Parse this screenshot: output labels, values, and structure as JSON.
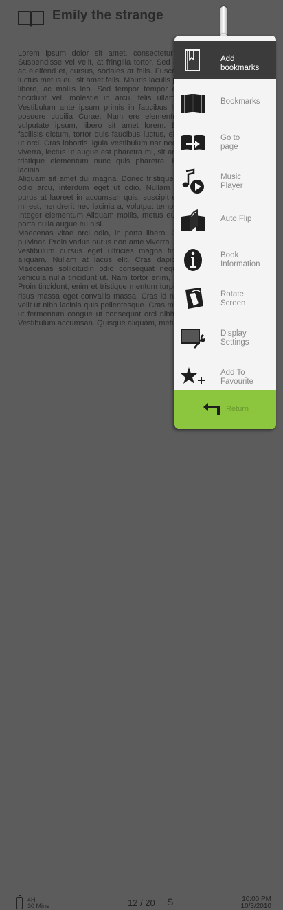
{
  "header": {
    "title": "Emily the strange"
  },
  "reader": {
    "paragraphs": [
      "Lorem ipsum dolor sit amet, consectetur adipiscing elit. Suspendisse vel velit, at fringilla tortor. Sed dui augue, porta ac eleifend et, cursus, sodales at felis. Fusce a risus laoreet, luctus metus eu, sit amet felis. Mauris iaculis pellentesque orci libero, ac mollis leo. Sed tempor tempor orci, ornare non tincidunt vel, molestie in arcu. felis ullamcorper ultricies. Vestibulum ante ipsum primis in faucibus luctus et ultrices posuere cubilia Curae; Nam ere elementum, metus felis vulputate ipsum, libero sit amet lorem. Etiam commodo facilisis dictum, tortor quis faucibus luctus, elit libero odio elit ut orci. Cras lobortis ligula vestibulum nar neque lobortis. Sed viverra, lectus ut augue est pharetra mi, sit amet lobortis risus tristique elementum nunc quis pharetra. Etiam commodo lacinia.",
      "Aliquam sit amet dui magna. Donec tristique tristique. Donec odio arcu, interdum eget ut odio. Nullam feugiat vehicula purus at laoreet in accumsan quis, suscipit eu sapien. Morbi mi est, hendrerit nec lacinia a, volutpat tempor ornare varius. Integer elementum Aliquam mollis, metus eu mollis placerat, porta nulla augue eu nisl.",
      "Maecenas vitae orci odio, in porta libero. Quisque egestas pulvinar. Proin varius purus non ante viverra. In feugiat aliquet vestibulum cursus eget ultricies magna tincidunt. Aliquam aliquam. Nullam at lacus elit. Cras dapibus consectetur. Maecenas sollicitudin odio consequat neque laoreet. Sed vehicula nulla tincidunt ut. Nam tortor enim, suscipit sed nisl. Proin tincidunt, enim et tristique mentum turpis, vitae tincidunt risus massa eget convallis massa. Cras id nunc risus. luctus velit ut nibh lacinia quis pellentesque. Cras malesuada, neque ut fermentum congue ut consequat orci nibh imperdiet risus. Vestibulum accumsan. Quisque aliquam, metus a sodales"
    ]
  },
  "menu": {
    "items": [
      {
        "label": "Add\nbookmarks",
        "icon": "add-bookmark-icon",
        "active": true
      },
      {
        "label": "Bookmarks",
        "icon": "bookmarks-icon"
      },
      {
        "label": "Go to\npage",
        "icon": "go-to-page-icon"
      },
      {
        "label": "Music\nPlayer",
        "icon": "music-player-icon"
      },
      {
        "label": "Auto Flip",
        "icon": "auto-flip-icon"
      },
      {
        "label": "Book\nInformation",
        "icon": "info-icon"
      },
      {
        "label": "Rotate\nScreen",
        "icon": "rotate-screen-icon"
      },
      {
        "label": "Display\nSettings",
        "icon": "display-settings-icon"
      },
      {
        "label": "Add To\nFavourite",
        "icon": "add-favourite-icon"
      }
    ],
    "return_label": "Return"
  },
  "status": {
    "battery_line1": "4H",
    "battery_line2": "30 Mins",
    "page_counter": "12 / 20",
    "page_marker": "S",
    "time": "10:00 PM",
    "date": "10/3/2010"
  },
  "colors": {
    "background": "#5c5c5c",
    "menu_bg": "#f4f4f4",
    "active_item": "#3b3b3b",
    "return_green": "#8cc63f"
  }
}
